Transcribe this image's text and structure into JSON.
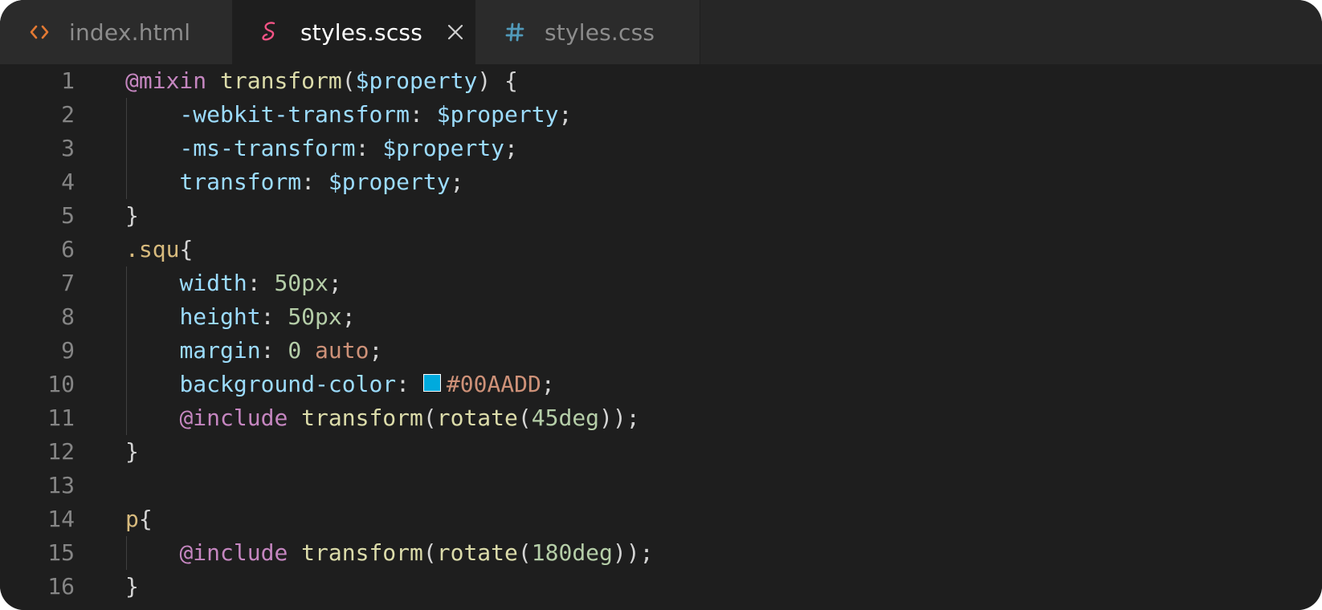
{
  "tabs": [
    {
      "label": "index.html",
      "icon": "html-file-icon",
      "active": false
    },
    {
      "label": "styles.scss",
      "icon": "sass-file-icon",
      "active": true
    },
    {
      "label": "styles.css",
      "icon": "css-file-icon",
      "active": false
    }
  ],
  "colors": {
    "html_icon": "#e37933",
    "sass_icon": "#f55385",
    "css_icon": "#519aba",
    "swatch": "#00AADD"
  },
  "lines": [
    {
      "n": "1",
      "tokens": [
        [
          "at",
          "@mixin"
        ],
        [
          "punc",
          " "
        ],
        [
          "fn",
          "transform"
        ],
        [
          "punc",
          "("
        ],
        [
          "var",
          "$property"
        ],
        [
          "punc",
          ") {"
        ]
      ]
    },
    {
      "n": "2",
      "tokens": [
        [
          "punc",
          "    "
        ],
        [
          "prop",
          "-webkit-transform"
        ],
        [
          "punc",
          ": "
        ],
        [
          "var",
          "$property"
        ],
        [
          "punc",
          ";"
        ]
      ]
    },
    {
      "n": "3",
      "tokens": [
        [
          "punc",
          "    "
        ],
        [
          "prop",
          "-ms-transform"
        ],
        [
          "punc",
          ": "
        ],
        [
          "var",
          "$property"
        ],
        [
          "punc",
          ";"
        ]
      ]
    },
    {
      "n": "4",
      "tokens": [
        [
          "punc",
          "    "
        ],
        [
          "prop",
          "transform"
        ],
        [
          "punc",
          ": "
        ],
        [
          "var",
          "$property"
        ],
        [
          "punc",
          ";"
        ]
      ]
    },
    {
      "n": "5",
      "tokens": [
        [
          "punc",
          "}"
        ]
      ]
    },
    {
      "n": "6",
      "tokens": [
        [
          "sel",
          ".squ"
        ],
        [
          "punc",
          "{"
        ]
      ]
    },
    {
      "n": "7",
      "tokens": [
        [
          "punc",
          "    "
        ],
        [
          "prop",
          "width"
        ],
        [
          "punc",
          ": "
        ],
        [
          "num",
          "50px"
        ],
        [
          "punc",
          ";"
        ]
      ]
    },
    {
      "n": "8",
      "tokens": [
        [
          "punc",
          "    "
        ],
        [
          "prop",
          "height"
        ],
        [
          "punc",
          ": "
        ],
        [
          "num",
          "50px"
        ],
        [
          "punc",
          ";"
        ]
      ]
    },
    {
      "n": "9",
      "tokens": [
        [
          "punc",
          "    "
        ],
        [
          "prop",
          "margin"
        ],
        [
          "punc",
          ": "
        ],
        [
          "num",
          "0"
        ],
        [
          "punc",
          " "
        ],
        [
          "kw",
          "auto"
        ],
        [
          "punc",
          ";"
        ]
      ]
    },
    {
      "n": "10",
      "tokens": [
        [
          "punc",
          "    "
        ],
        [
          "prop",
          "background-color"
        ],
        [
          "punc",
          ": "
        ],
        [
          "swatch",
          ""
        ],
        [
          "str",
          "#00AADD"
        ],
        [
          "punc",
          ";"
        ]
      ]
    },
    {
      "n": "11",
      "tokens": [
        [
          "punc",
          "    "
        ],
        [
          "at",
          "@include"
        ],
        [
          "punc",
          " "
        ],
        [
          "fn",
          "transform"
        ],
        [
          "punc",
          "("
        ],
        [
          "fn",
          "rotate"
        ],
        [
          "punc",
          "("
        ],
        [
          "num",
          "45deg"
        ],
        [
          "punc",
          "));"
        ]
      ]
    },
    {
      "n": "12",
      "tokens": [
        [
          "punc",
          "}"
        ]
      ]
    },
    {
      "n": "13",
      "tokens": []
    },
    {
      "n": "14",
      "tokens": [
        [
          "sel",
          "p"
        ],
        [
          "punc",
          "{"
        ]
      ]
    },
    {
      "n": "15",
      "tokens": [
        [
          "punc",
          "    "
        ],
        [
          "at",
          "@include"
        ],
        [
          "punc",
          " "
        ],
        [
          "fn",
          "transform"
        ],
        [
          "punc",
          "("
        ],
        [
          "fn",
          "rotate"
        ],
        [
          "punc",
          "("
        ],
        [
          "num",
          "180deg"
        ],
        [
          "punc",
          "));"
        ]
      ]
    },
    {
      "n": "16",
      "tokens": [
        [
          "punc",
          "}"
        ]
      ]
    }
  ]
}
